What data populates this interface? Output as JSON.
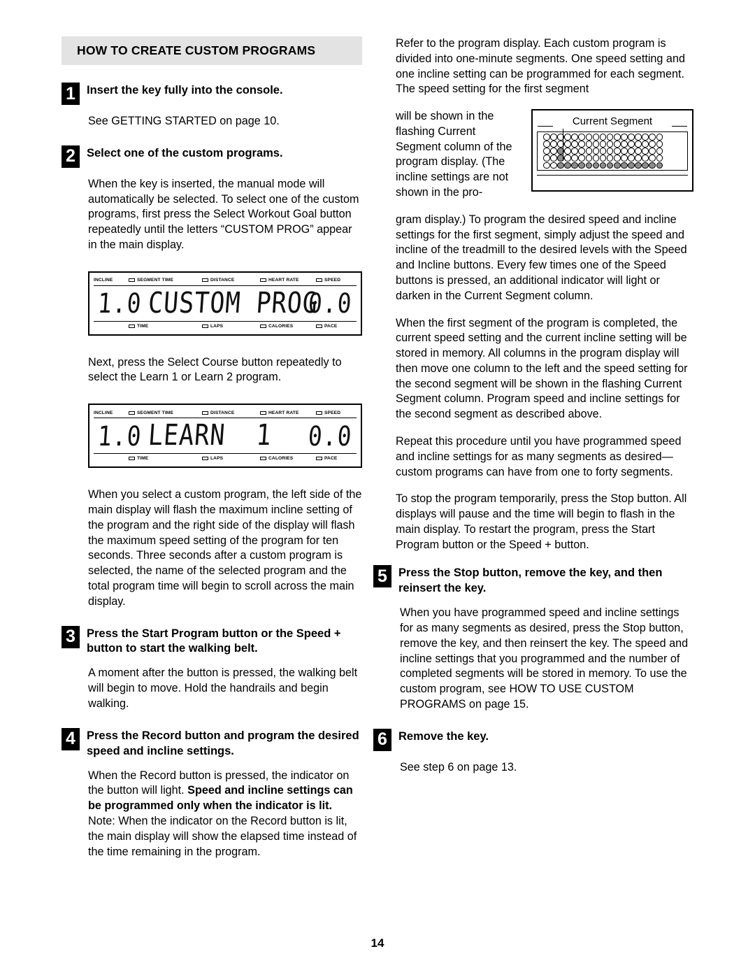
{
  "document": {
    "page_number": "14",
    "section_title": "HOW TO CREATE CUSTOM PROGRAMS"
  },
  "left_column": {
    "step1": {
      "number": "1",
      "title": "Insert the key fully into the console.",
      "body": "See GETTING STARTED on page 10."
    },
    "step2": {
      "number": "2",
      "title": "Select one of the custom programs.",
      "body1": "When the key is inserted, the manual mode will automatically be selected. To select one of the custom programs, first press the Select Workout Goal button repeatedly until the letters “CUSTOM PROG” appear in the main display.",
      "body2": "Next, press the Select Course button repeatedly to select the Learn 1 or Learn 2 program.",
      "body3": "When you select a custom program, the left side of the main display will flash the maximum incline setting of the program and the right side of the display will flash the maximum speed setting of the program for ten seconds. Three seconds after a custom program is selected, the name of the selected program and the total program time will begin to scroll across the main display."
    },
    "step3": {
      "number": "3",
      "title": "Press the Start Program button or the Speed + button to start the walking belt.",
      "body": "A moment after the button is pressed, the walking belt will begin to move. Hold the handrails and begin walking."
    },
    "step4": {
      "number": "4",
      "title": "Press the Record button and program the desired speed and incline settings.",
      "body_part1": "When the Record button is pressed, the indicator on the button will light. ",
      "body_bold": "Speed and incline settings can be programmed only when the indicator is lit.",
      "body_part2": " Note: When the indicator on the Record button is lit, the main display will show the elapsed time instead of the time remaining in the program."
    }
  },
  "console_display_1": {
    "top_labels": [
      "INCLINE",
      "SEGMENT TIME",
      "DISTANCE",
      "HEART RATE",
      "SPEED"
    ],
    "bottom_labels": [
      "TIME",
      "LAPS",
      "CALORIES",
      "PACE"
    ],
    "value_left": "1.0",
    "value_main": "CUSTOM PROG",
    "value_right": "0.0"
  },
  "console_display_2": {
    "top_labels": [
      "INCLINE",
      "SEGMENT TIME",
      "DISTANCE",
      "HEART RATE",
      "SPEED"
    ],
    "bottom_labels": [
      "TIME",
      "LAPS",
      "CALORIES",
      "PACE"
    ],
    "value_left": "1.0",
    "value_main": "LEARN  1",
    "value_right": "0.0"
  },
  "program_display_figure": {
    "caption": "Current Segment",
    "rows": 5,
    "columns": 17,
    "pointer_column": 3,
    "filled": [
      [
        0,
        0,
        0,
        0,
        0,
        0,
        0,
        0,
        0,
        0,
        0,
        0,
        0,
        0,
        0,
        0,
        0
      ],
      [
        0,
        0,
        0,
        0,
        0,
        0,
        0,
        0,
        0,
        0,
        0,
        0,
        0,
        0,
        0,
        0,
        0
      ],
      [
        0,
        0,
        1,
        0,
        0,
        0,
        0,
        0,
        0,
        0,
        0,
        0,
        0,
        0,
        0,
        0,
        0
      ],
      [
        0,
        0,
        1,
        0,
        0,
        0,
        0,
        0,
        0,
        0,
        0,
        0,
        0,
        0,
        0,
        0,
        0
      ],
      [
        0,
        0,
        1,
        1,
        1,
        1,
        1,
        1,
        1,
        1,
        1,
        1,
        1,
        1,
        1,
        1,
        1
      ]
    ],
    "dot_on_color": "#8d8d8d",
    "dot_off_color": "#ffffff"
  },
  "right_column": {
    "para1": "Refer to the program display. Each custom program is divided into one-minute segments. One speed setting and one incline setting can be programmed for each segment. The speed setting for the first segment",
    "para2": "will be shown in the flashing Current Segment column of the program display. (The incline settings are not shown in the pro-",
    "para3": "gram display.) To program the desired speed and incline settings for the first segment, simply adjust the speed and incline of the treadmill to the desired levels with the Speed and Incline buttons. Every few times one of the Speed buttons is pressed, an additional indicator will light or darken in the Current Segment column.",
    "para4": "When the first segment of the program is completed, the current speed setting and the current incline setting will be stored in memory. All columns in the program display will then move one column to the left and the speed setting for the second segment will be shown in the flashing Current Segment column. Program speed and incline settings for the second segment as described above.",
    "para5": "Repeat this procedure until you have programmed speed and incline settings for as many segments as desired—custom programs can have from one to forty segments.",
    "para6": "To stop the program temporarily, press the Stop button. All displays will pause and the time will begin to flash in the main display. To restart the program, press the Start Program button or the Speed + button.",
    "step5": {
      "number": "5",
      "title": "Press the Stop button, remove the key, and then reinsert the key.",
      "body": "When you have programmed speed and incline settings for as many segments as desired, press the Stop button, remove the key, and then reinsert the key. The speed and incline settings that you programmed and the number of completed segments will be stored in memory. To use the custom program, see HOW TO USE CUSTOM PROGRAMS on page 15."
    },
    "step6": {
      "number": "6",
      "title": "Remove the key.",
      "body": "See step 6 on page 13."
    }
  }
}
